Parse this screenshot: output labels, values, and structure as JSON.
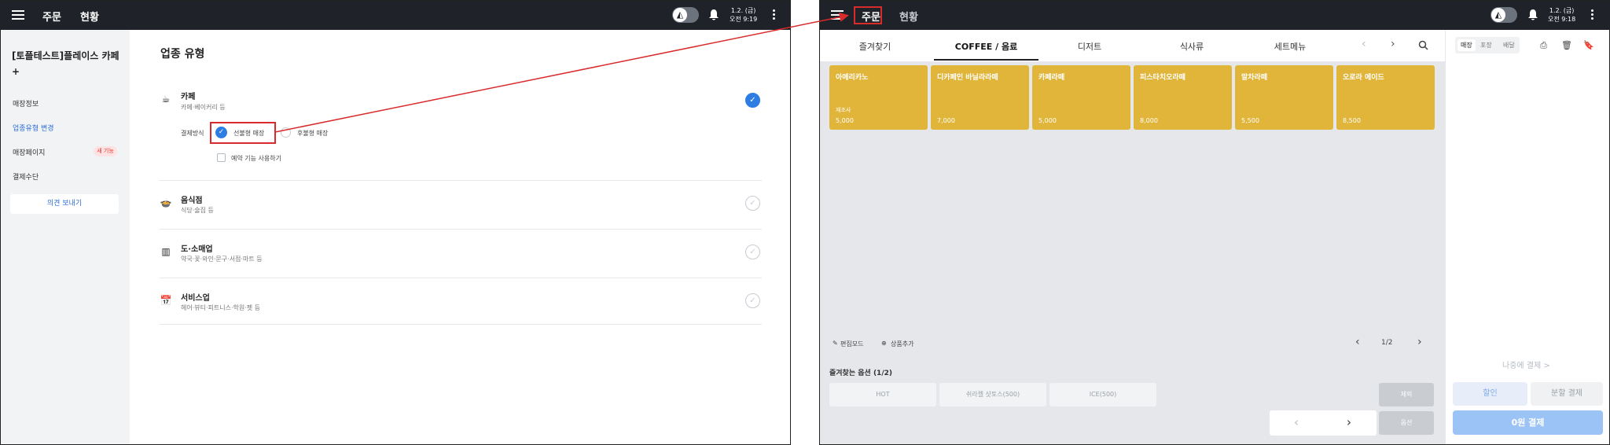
{
  "left": {
    "header": {
      "nav": [
        "주문",
        "현황"
      ],
      "date": "1.2. (금)",
      "time": "오전 9:19"
    },
    "sidebar": {
      "store_name": "[토플테스트]플레이스 카페+",
      "items": [
        "매장정보",
        "업종유형 변경",
        "매장페이지",
        "결제수단"
      ],
      "new_badge": "새 기능",
      "feedback_button": "의견 보내기"
    },
    "main": {
      "title": "업종 유형",
      "types": [
        {
          "title": "카페",
          "desc": "카페·베이커리 등",
          "icon": "coffee-cup-icon",
          "glyph": "☕",
          "selected": true
        },
        {
          "title": "음식점",
          "desc": "식당·술집 등",
          "icon": "dish-icon",
          "glyph": "🍲",
          "selected": false
        },
        {
          "title": "도·소매업",
          "desc": "약국·꽃·와인·문구·서점·마트 등",
          "icon": "barcode-icon",
          "glyph": "▥",
          "selected": false
        },
        {
          "title": "서비스업",
          "desc": "헤어·뷰티·피트니스·학원·펫 등",
          "icon": "calendar-icon",
          "glyph": "📅",
          "selected": false
        }
      ],
      "payment_label": "결제방식",
      "prepay_label": "선불형 매장",
      "postpay_label": "후불형 매장",
      "reservation_label": "예약 기능 사용하기"
    }
  },
  "right": {
    "header": {
      "nav": [
        "주문",
        "현황"
      ],
      "date": "1.2. (금)",
      "time": "오전 9:18"
    },
    "tabs": [
      "즐겨찾기",
      "COFFEE / 음료",
      "디저트",
      "식사류",
      "세트메뉴"
    ],
    "menu_cards": [
      {
        "name": "아메리카노",
        "sub": "재조사",
        "price": "5,000"
      },
      {
        "name": "디카페인 바닐라라떼",
        "sub": "",
        "price": "7,000"
      },
      {
        "name": "카페라떼",
        "sub": "",
        "price": "5,000"
      },
      {
        "name": "피스타치오라떼",
        "sub": "",
        "price": "8,000"
      },
      {
        "name": "말차라떼",
        "sub": "",
        "price": "5,500"
      },
      {
        "name": "오로라 에이드",
        "sub": "",
        "price": "8,500"
      }
    ],
    "tools": {
      "edit_mode": "편집모드",
      "add_item": "상품추가",
      "page": "1/2"
    },
    "favorite_options": {
      "title": "즐겨찾는 옵션 (1/2)",
      "options": [
        "HOT",
        "쉬라켈 샷토스(500)",
        "ICE(500)"
      ],
      "delete_button": "제외",
      "option_button": "옵션"
    },
    "cart": {
      "order_types": [
        "매장",
        "포장",
        "배달"
      ],
      "later_pay": "나중에 결제 >",
      "discount_button": "할인",
      "split_button": "분할 결제",
      "pay_button": "0원 결제"
    }
  },
  "colors": {
    "accent": "#2d7de3",
    "card": "#e0b53a",
    "topbar": "#1f2329",
    "highlight": "#d92b2b"
  }
}
